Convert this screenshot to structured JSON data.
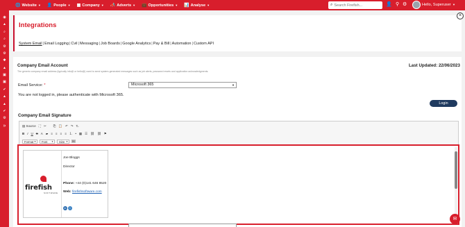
{
  "topbar": {
    "nav": [
      {
        "label": "Website",
        "icon": "globe-icon"
      },
      {
        "label": "People",
        "icon": "person-icon"
      },
      {
        "label": "Company",
        "icon": "building-icon"
      },
      {
        "label": "Adverts",
        "icon": "megaphone-icon"
      },
      {
        "label": "Opportunities",
        "icon": "briefcase-icon"
      },
      {
        "label": "Analyse",
        "icon": "chart-icon"
      }
    ],
    "search_placeholder": "Search Firefish...",
    "greeting": "Hello, Superuser"
  },
  "page": {
    "title": "Integrations",
    "tabs": [
      "System Email",
      "Email Logging",
      "Cvil",
      "Messaging",
      "Job Boards",
      "Google Analytics",
      "Pay & Bill",
      "Automation",
      "Custom API"
    ],
    "active_tab": "System Email"
  },
  "company_email": {
    "heading": "Company Email Account",
    "last_updated": "Last Updated: 22/06/2023",
    "description": "The generic company email address (typically info@ or hello@) used to send system-generated messages such as job alerts, password resets and application acknowledgments.",
    "service_label": "Email Service:",
    "service_required": "*",
    "service_value": "Microsoft 365",
    "status_message": "You are not logged in, please authenticate with Microsoft 365.",
    "login_label": "Login"
  },
  "signature": {
    "heading": "Company Email Signature",
    "toolbar": {
      "source_label": "Source",
      "format_label": "Format",
      "font_label": "Font",
      "size_label": "Size"
    },
    "name": "Joe Bloggs",
    "role": "Director",
    "phone_label": "Phone:",
    "phone_value": "+44 (0)141 646 8520",
    "web_label": "Web:",
    "web_value": "firefishsoftware.com",
    "logo_word": "firefish",
    "logo_sub": "SOFTWARE"
  },
  "colors": {
    "brand_red": "#d81e2c",
    "login_navy": "#1f3a5f"
  }
}
